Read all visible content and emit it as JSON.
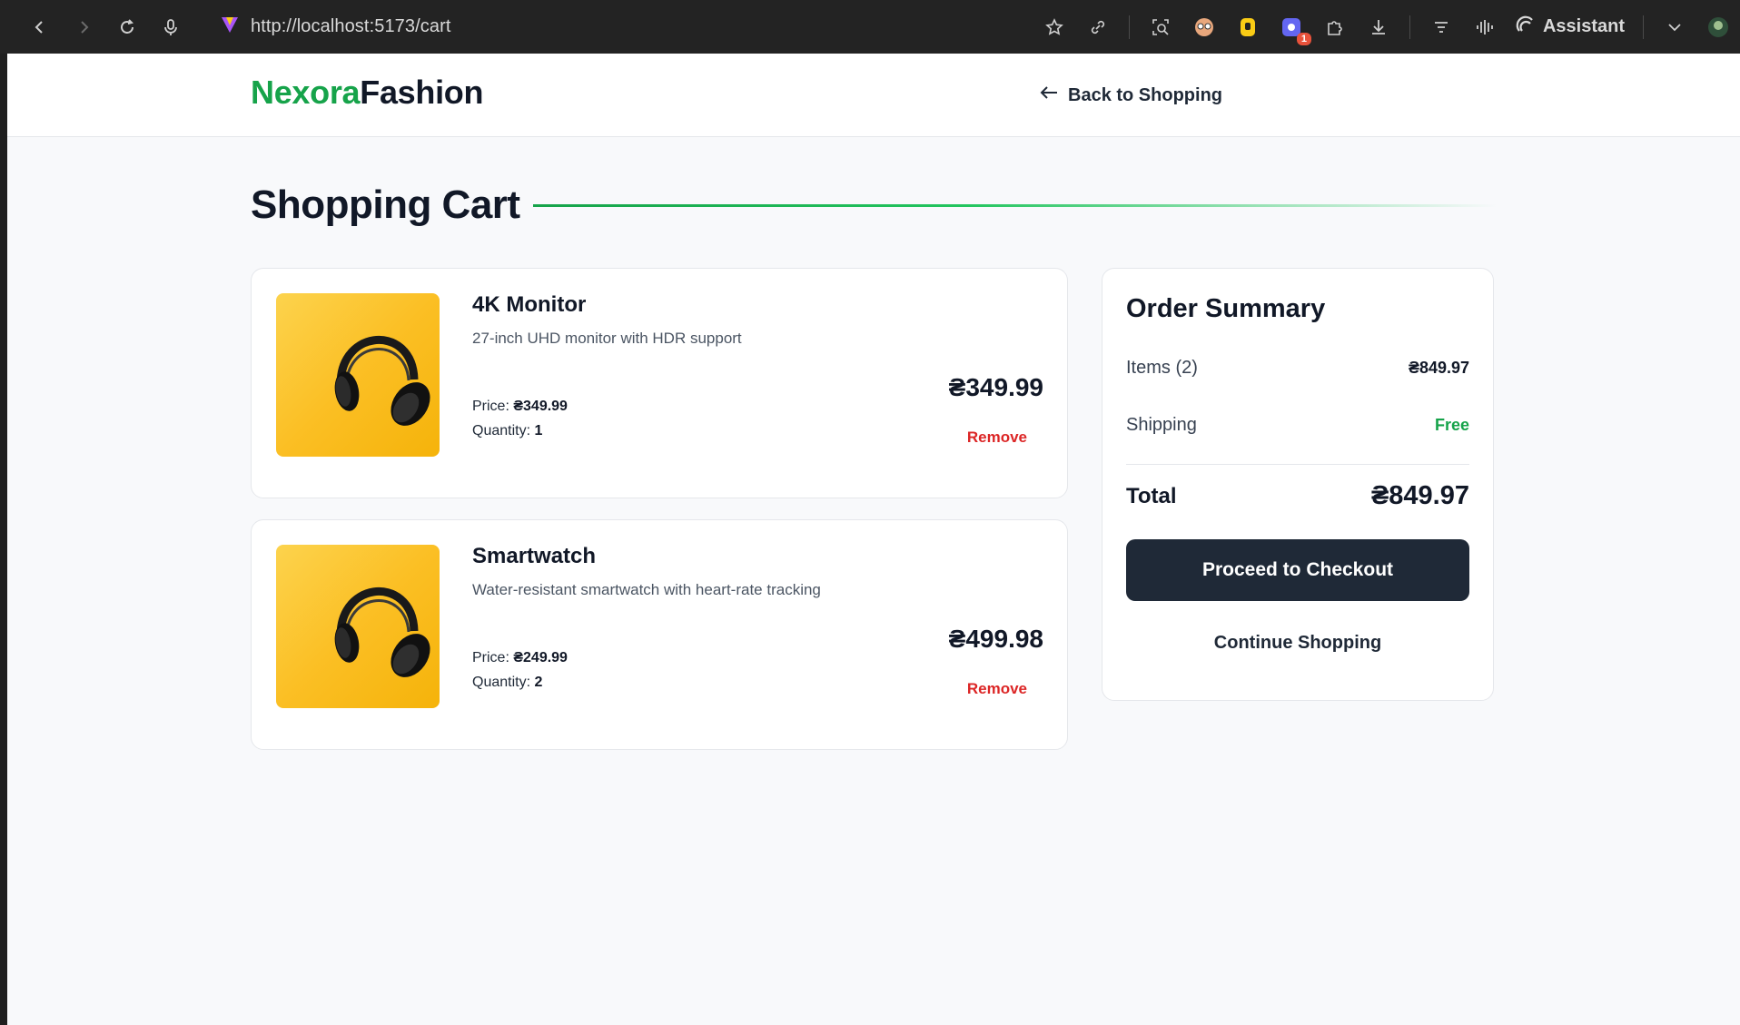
{
  "browser": {
    "url": "http://localhost:5173/cart",
    "assistant_label": "Assistant",
    "extension_badge": "1"
  },
  "site": {
    "logo_part1": "Nexora",
    "logo_part2": "Fashion",
    "back_link": "Back to Shopping",
    "colors": {
      "accent": "#16a34a",
      "dark": "#1f2937",
      "danger": "#dc2626"
    }
  },
  "page": {
    "title": "Shopping Cart"
  },
  "cart": {
    "items": [
      {
        "name": "4K Monitor",
        "description": "27-inch UHD monitor with HDR support",
        "price_label": "Price: ",
        "price": "₴349.99",
        "quantity_label": "Quantity: ",
        "quantity": "1",
        "total": "₴349.99",
        "remove_label": "Remove",
        "image_icon": "headphones-icon"
      },
      {
        "name": "Smartwatch",
        "description": "Water-resistant smartwatch with heart-rate tracking",
        "price_label": "Price: ",
        "price": "₴249.99",
        "quantity_label": "Quantity: ",
        "quantity": "2",
        "total": "₴499.98",
        "remove_label": "Remove",
        "image_icon": "headphones-icon"
      }
    ]
  },
  "summary": {
    "title": "Order Summary",
    "items_label": "Items (2)",
    "items_value": "₴849.97",
    "shipping_label": "Shipping",
    "shipping_value": "Free",
    "total_label": "Total",
    "total_value": "₴849.97",
    "checkout_label": "Proceed to Checkout",
    "continue_label": "Continue Shopping"
  }
}
